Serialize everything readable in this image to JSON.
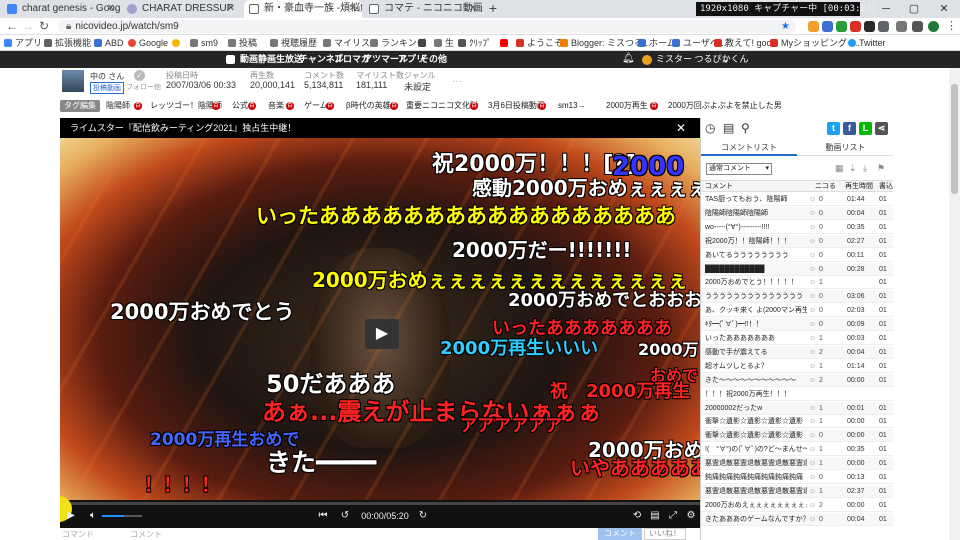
{
  "browser": {
    "tabs": [
      {
        "title": "charat genesis - Google 検索",
        "active": false,
        "favcolor": "#4285f4"
      },
      {
        "title": "CHARAT DRESSUP",
        "active": false,
        "favcolor": "#a0a0d0"
      },
      {
        "title": "新・豪血寺一族 -煩悩解放",
        "active": true,
        "favcolor": "#777777"
      },
      {
        "title": "コマテ - ニコニコ動画",
        "active": false,
        "favcolor": "#777777"
      }
    ],
    "new_tab": "+",
    "capture_text": "1920x1080 キャプチャー中 [00:03:02]",
    "url": "nicovideo.jp/watch/sm9",
    "bookmarks": [
      "アプリ",
      "拡張機能",
      "ABD",
      "Google",
      "",
      "sm9",
      "投稿",
      "視聴履歴",
      "マイリスト",
      "ランキング",
      "",
      "生",
      "ｸﾘｯﾌﾟ",
      "",
      "ようこそ",
      "Blogger: ミスつる...",
      "ホーム",
      "ユーザベ...",
      "教えて! goo",
      "Myショッピング -...",
      "Twitter"
    ]
  },
  "nico": {
    "nav": [
      "動画",
      "静画",
      "生放送",
      "チャンネル",
      "ブロマガ",
      "アツマール",
      "アプリ",
      "その他"
    ],
    "user": "ミスター つるぴかくん"
  },
  "video_info": {
    "uploader": "中の さん",
    "uploader_badge": "投稿動画",
    "follow": "フォロー他",
    "posted_label": "投稿日時",
    "posted": "2007/03/06 00:33",
    "views_label": "再生数",
    "views": "20,000,141",
    "comments_label": "コメント数",
    "comments": "5,134,811",
    "mylist_label": "マイリスト数",
    "mylist": "181,111",
    "genre_label": "ジャンル",
    "genre": "未設定",
    "more": "…"
  },
  "tags": {
    "edit_label": "タグ編集",
    "items": [
      "陰陽師",
      "レッツゴー！陰陽師",
      "公式",
      "音楽",
      "ゲーム",
      "β時代の英雄",
      "重要ニコニコ文化財",
      "3月6日投稿動画",
      "sm13→",
      "2000万再生",
      "2000万回ぷよぷよを禁止した男"
    ]
  },
  "player": {
    "banner": "ライムスター『配信飲みーティング2021』独占生中継！",
    "time": "00:00/05:20",
    "progress": 0.0,
    "comments": [
      {
        "text": "祝2000万！！！[?]",
        "color": "#ffffff"
      },
      {
        "text": "2000",
        "color": "#3333ff"
      },
      {
        "text": "感動2000万おめぇぇぇぇぇぇ",
        "color": "#ffffff"
      },
      {
        "text": "いったあああああああああああああああああ",
        "color": "#ffff00"
      },
      {
        "text": "2000万だー!!!!!!!",
        "color": "#ffffff"
      },
      {
        "text": "2000万おめぇぇぇぇぇぇぇぇぇぇぇぇぇ",
        "color": "#ffff00"
      },
      {
        "text": "2000万おめでとおおおおおおおおおおおおお",
        "color": "#ffffff"
      },
      {
        "text": "2000万おめでとう",
        "color": "#ffffff"
      },
      {
        "text": "いったあああああああ",
        "color": "#ff2222"
      },
      {
        "text": "2000万再生いいい",
        "color": "#33ccff"
      },
      {
        "text": "2000万",
        "color": "#ffffff"
      },
      {
        "text": "おめでとう！！！！",
        "color": "#ff2222"
      },
      {
        "text": "50だあああ",
        "color": "#ffffff"
      },
      {
        "text": "祝　2000万再生",
        "color": "#ff2222"
      },
      {
        "text": "あぁ...震えが止まらないぁぁぁ",
        "color": "#ff2222"
      },
      {
        "text": "2000万再生おめで",
        "color": "#4466ff"
      },
      {
        "text": "きた━━━━",
        "color": "#ffffff"
      },
      {
        "text": "2000万おめでと",
        "color": "#ffffff"
      },
      {
        "text": "いやあああああああああああああ！！！！！！！",
        "color": "#ff2222"
      },
      {
        "text": "！！！！",
        "color": "#ff2222"
      },
      {
        "text": "アアアアアア",
        "color": "#ff2222"
      }
    ]
  },
  "panel": {
    "tab_comments": "コメントリスト",
    "tab_related": "動画リスト",
    "sort": "通常コメント",
    "headers": [
      "コメント",
      "ニコる",
      "再生時間",
      "書込"
    ],
    "rows": [
      {
        "c": "TAS厨ってもおう、陰陽師",
        "n": "0",
        "t": "01:44",
        "w": "01"
      },
      {
        "c": "陰陽師陰陽師陰陽師",
        "n": "0",
        "t": "00:04",
        "w": "01"
      },
      {
        "c": "wo-----(°∀°)---------!!!!",
        "n": "0",
        "t": "00:35",
        "w": "01"
      },
      {
        "c": "祝2000万！！陰陽師！！！",
        "n": "0",
        "t": "02:27",
        "w": "01"
      },
      {
        "c": "あいてるうううううううう",
        "n": "0",
        "t": "00:11",
        "w": "01"
      },
      {
        "c": "████████████",
        "n": "0",
        "t": "00:28",
        "w": "01"
      },
      {
        "c": "2000万おめでとう！！！！！",
        "n": "1",
        "t": "",
        "w": "01"
      },
      {
        "c": "うううううううううううううう",
        "n": "0",
        "t": "03:06",
        "w": "01"
      },
      {
        "c": "あ、クッキ来く よ(2000マン再生記",
        "n": "0",
        "t": "02:03",
        "w": "01"
      },
      {
        "c": "ｷﾀ━(ﾟ∀ﾟ)━!!！！",
        "n": "0",
        "t": "00:09",
        "w": "01"
      },
      {
        "c": "いったあああああああ",
        "n": "1",
        "t": "00:03",
        "w": "01"
      },
      {
        "c": "感動で手が震えてる",
        "n": "2",
        "t": "00:04",
        "w": "01"
      },
      {
        "c": "超オムツしとるよ？",
        "n": "1",
        "t": "01:14",
        "w": "01"
      },
      {
        "c": "きた～～～～～～～～～～～",
        "n": "2",
        "t": "00:00",
        "w": "01"
      },
      {
        "c": "！！！祝2000万再生！！！",
        "n": "",
        "t": "",
        "w": ""
      },
      {
        "c": "20000002だったw",
        "n": "1",
        "t": "00:01",
        "w": "01"
      },
      {
        "c": "衝撃☆遺影☆遺影☆遺影☆遺影",
        "n": "1",
        "t": "00:00",
        "w": "01"
      },
      {
        "c": "衝撃☆遺影☆遺影☆遺影☆遺影",
        "n": "0",
        "t": "00:00",
        "w": "01"
      },
      {
        "c": "!(　°∀°)の(ﾟ∀ﾟ)の?ど～まんせ～まん♪(",
        "n": "1",
        "t": "00:35",
        "w": "01"
      },
      {
        "c": "悪霊退散悪霊退散悪霊退散悪霊退散",
        "n": "1",
        "t": "00:00",
        "w": "01"
      },
      {
        "c": "鈍痛鈍痛鈍痛鈍痛鈍痛鈍痛鈍痛",
        "n": "0",
        "t": "00:13",
        "w": "01"
      },
      {
        "c": "悪霊退散悪霊退散悪霊退散悪霊退散",
        "n": "1",
        "t": "02:37",
        "w": "01"
      },
      {
        "c": "2000万おめえぇぇぇぇぇぇぇぇぇ",
        "n": "2",
        "t": "00:00",
        "w": "01"
      },
      {
        "c": "きたあああのゲームなんですか？",
        "n": "0",
        "t": "00:04",
        "w": "01"
      }
    ]
  },
  "bottom": {
    "command_placeholder": "コマンド",
    "comment_placeholder": "コメント",
    "submit": "コメント",
    "like": "いいね！"
  }
}
